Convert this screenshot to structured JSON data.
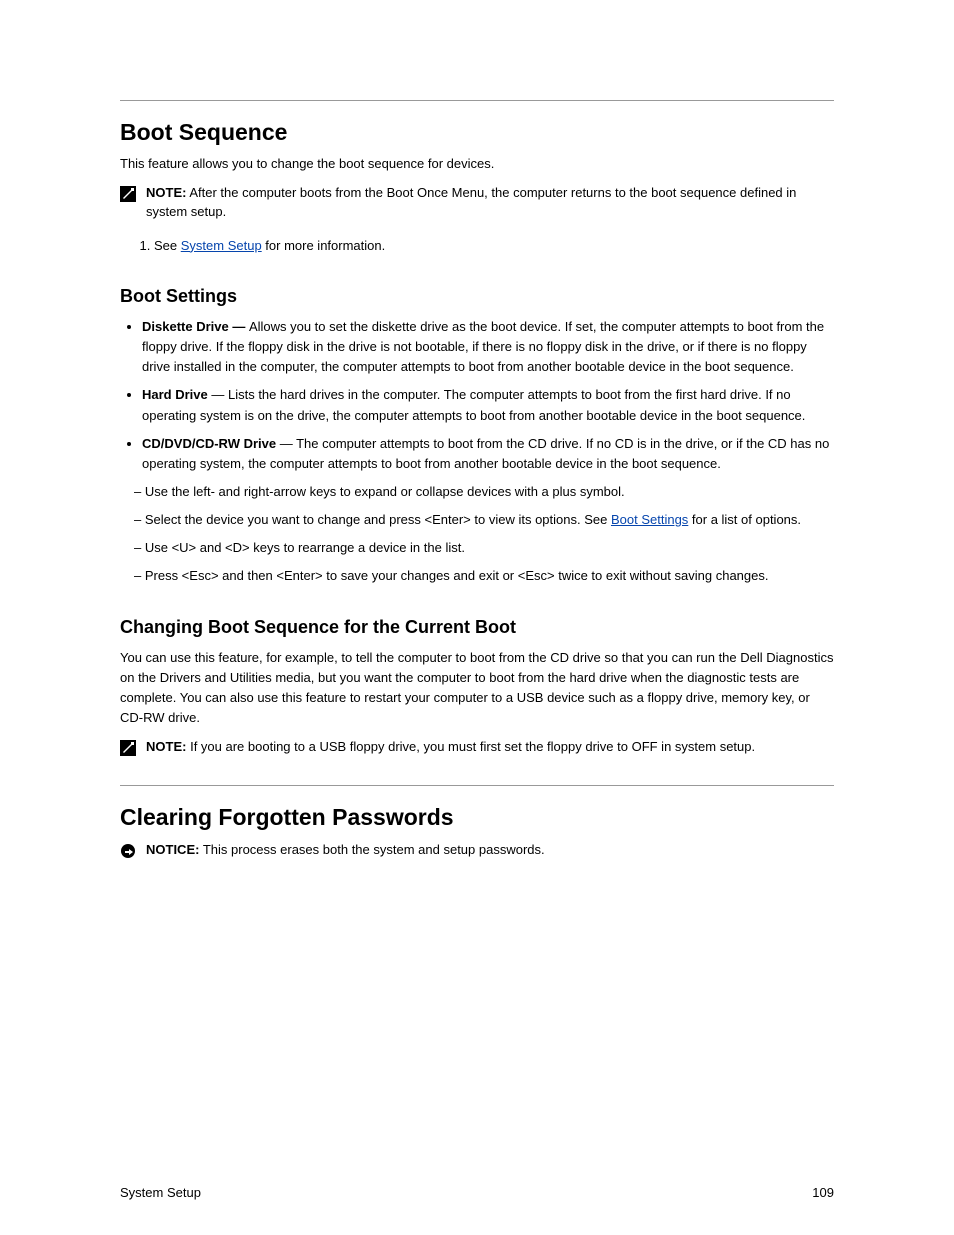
{
  "section1": {
    "title": "Boot Sequence",
    "intro": "This feature allows you to change the boot sequence for devices.",
    "note_label": "NOTE:",
    "note_text": "After the computer boots from the Boot Once Menu, the computer returns to the boot sequence defined in system setup.",
    "step1a": "See ",
    "step1_link": "System Setup",
    "step1b": " for more information.",
    "list_heading": "Boot Settings",
    "bullets": [
      {
        "bold": "Diskette Drive — ",
        "text": "Allows you to set the diskette drive as the boot device. If set, the computer attempts to boot from the floppy drive. If the floppy disk in the drive is not bootable, if there is no floppy disk in the drive, or if there is no floppy drive installed in the computer, the computer attempts to boot from another bootable device in the boot sequence."
      },
      {
        "bold": "Hard Drive",
        "text": " — Lists the hard drives in the computer. The computer attempts to boot from the first hard drive. If no operating system is on the drive, the computer attempts to boot from another bootable device in the boot sequence."
      },
      {
        "bold": "CD/DVD/CD-RW Drive",
        "text": " — The computer attempts to boot from the CD drive. If no CD is in the drive, or if the CD has no operating system, the computer attempts to boot from another bootable device in the boot sequence."
      }
    ],
    "dashes": [
      "Use the left- and right-arrow keys to expand or collapse devices with a plus symbol.",
      [
        "Select the device you want to change and press <Enter> to view its options. See ",
        "Boot Settings",
        " for a list of options."
      ],
      "Use <U> and <D> keys to rearrange a device in the list.",
      "Press <Esc> and then <Enter> to save your changes and exit or <Esc> twice to exit without saving changes."
    ],
    "changing_heading": "Changing Boot Sequence for the Current Boot",
    "changing_text": "You can use this feature, for example, to tell the computer to boot from the CD drive so that you can run the Dell Diagnostics on the Drivers and Utilities media, but you want the computer to boot from the hard drive when the diagnostic tests are complete. You can also use this feature to restart your computer to a USB device such as a floppy drive, memory key, or CD-RW drive.",
    "note2_label": "NOTE:",
    "note2_text": "If you are booting to a USB floppy drive, you must first set the floppy drive to OFF in system setup."
  },
  "section2": {
    "title": "Clearing Forgotten Passwords",
    "notice_label": "NOTICE:",
    "notice_text": "This process erases both the system and setup passwords."
  },
  "footer": {
    "page": "109",
    "chapter": "System Setup"
  }
}
